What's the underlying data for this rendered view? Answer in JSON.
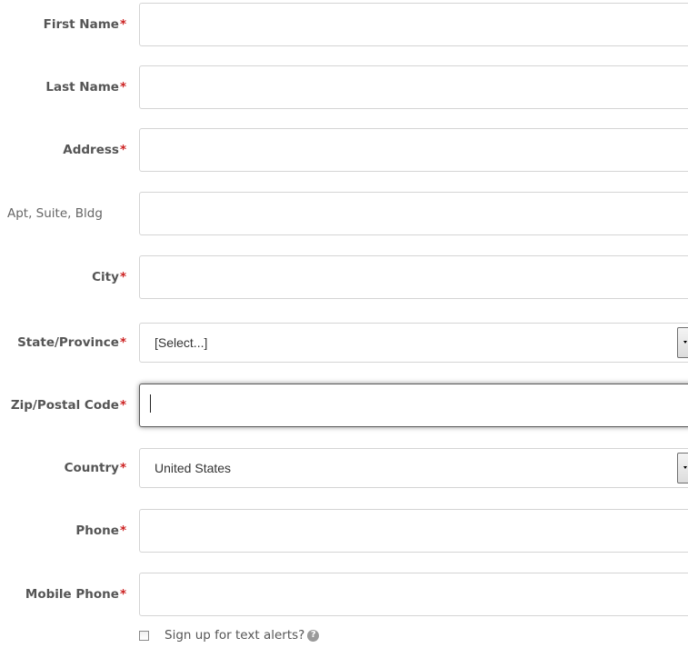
{
  "form": {
    "fields": [
      {
        "label": "First Name",
        "required": "*",
        "value": ""
      },
      {
        "label": "Last Name",
        "required": "*",
        "value": ""
      },
      {
        "label": "Address",
        "required": "*",
        "value": ""
      },
      {
        "label": "Apt, Suite, Bldg",
        "value": ""
      },
      {
        "label": "City",
        "required": "*",
        "value": ""
      },
      {
        "label": "State/Province",
        "required": "*",
        "selected": "[Select...]"
      },
      {
        "label": "Zip/Postal Code",
        "required": "*",
        "value": ""
      },
      {
        "label": "Country",
        "required": "*",
        "selected": "United States"
      },
      {
        "label": "Phone",
        "required": "*",
        "value": ""
      },
      {
        "label": "Mobile Phone",
        "required": "*",
        "value": ""
      }
    ],
    "text_alerts": {
      "label": "Sign up for text alerts?",
      "checked": false,
      "help_icon": "question-circle-icon"
    }
  },
  "colors": {
    "required_asterisk": "#cc2222",
    "label_text": "#555555",
    "field_border": "#d4d4d4"
  }
}
